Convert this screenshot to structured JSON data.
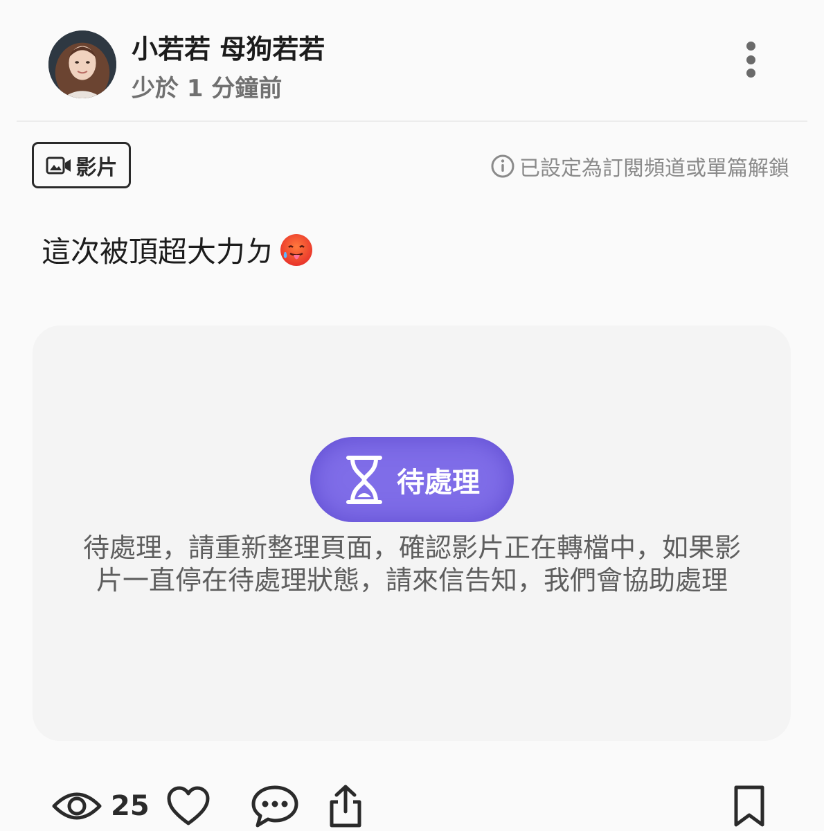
{
  "post": {
    "author_name": "小若若 母狗若若",
    "time_ago": "少於 1 分鐘前",
    "type_label": "影片",
    "lock_info": "已設定為訂閱頻道或單篇解鎖",
    "caption": "這次被頂超大力ㄉ"
  },
  "video": {
    "status_label": "待處理",
    "status_message": "待處理，請重新整理頁面，確認影片正在轉檔中，如果影片一直停在待處理狀態，請來信告知，我們會協助處理"
  },
  "actions": {
    "views_count": "25"
  },
  "colors": {
    "pending_pill": "#7f6de8",
    "icon_dark": "#2a2a2a",
    "muted_text": "#8a8a8a"
  },
  "icons": {
    "more": "more-vertical-icon",
    "chip": "video-camera-icon",
    "info": "info-circle-icon",
    "emoji": "hot-face-emoji",
    "pending": "hourglass-icon",
    "views": "eye-icon",
    "like": "heart-icon",
    "comment": "chat-bubble-icon",
    "share": "share-icon",
    "bookmark": "bookmark-icon"
  }
}
